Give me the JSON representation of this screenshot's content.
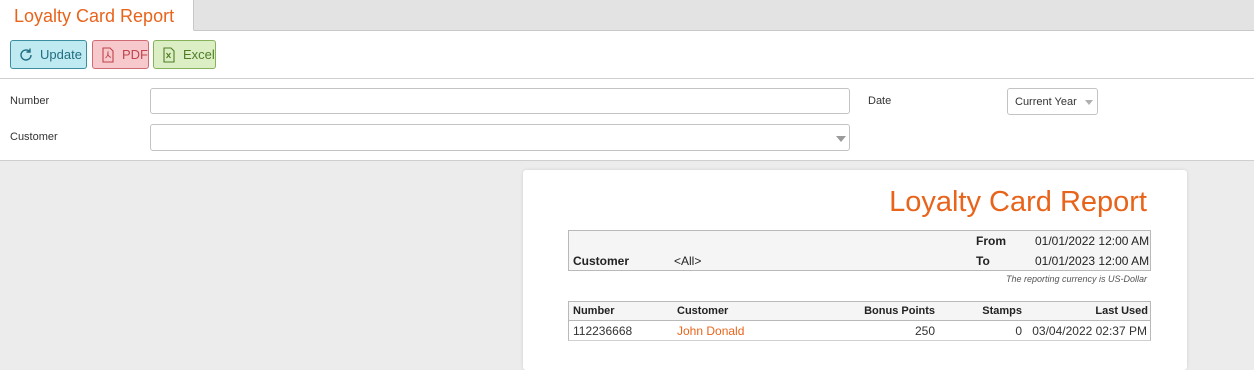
{
  "tab": {
    "title": "Loyalty Card Report"
  },
  "toolbar": {
    "update_label": "Update",
    "pdf_label": "PDF",
    "excel_label": "Excel"
  },
  "filters": {
    "number_label": "Number",
    "number_value": "",
    "customer_label": "Customer",
    "customer_value": "",
    "date_label": "Date",
    "date_value": "Current Year"
  },
  "report": {
    "title": "Loyalty Card Report",
    "customer_label": "Customer",
    "customer_value": "<All>",
    "from_label": "From",
    "from_value": "01/01/2022 12:00 AM",
    "to_label": "To",
    "to_value": "01/01/2023 12:00 AM",
    "currency_note": "The reporting currency is US-Dollar",
    "columns": {
      "number": "Number",
      "customer": "Customer",
      "bonus_points": "Bonus Points",
      "stamps": "Stamps",
      "last_used": "Last Used"
    },
    "rows": [
      {
        "number": "112236668",
        "customer": "John Donald",
        "bonus_points": "250",
        "stamps": "0",
        "last_used": "03/04/2022 02:37 PM"
      }
    ]
  },
  "colors": {
    "accent": "#e8641b",
    "update": "#bfeaf2",
    "pdf": "#f7c9cc",
    "excel": "#dcefc4"
  },
  "icons": {
    "update": "refresh-icon",
    "pdf": "pdf-file-icon",
    "excel": "excel-file-icon",
    "dropdown": "caret-down-icon"
  }
}
